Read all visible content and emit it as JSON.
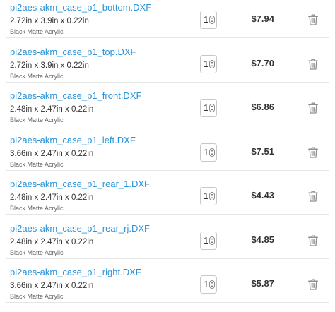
{
  "colors": {
    "link": "#2a93d8",
    "text": "#333333",
    "muted": "#666666",
    "price": "#333333",
    "icon": "#8e8e8e"
  },
  "cart": {
    "items": [
      {
        "name": "pi2aes-akm_case_p1_bottom.DXF",
        "dimensions": "2.72in x 3.9in x 0.22in",
        "material": "Black Matte Acrylic",
        "quantity": "1",
        "price": "$7.94",
        "delete_icon": "trash-icon"
      },
      {
        "name": "pi2aes-akm_case_p1_top.DXF",
        "dimensions": "2.72in x 3.9in x 0.22in",
        "material": "Black Matte Acrylic",
        "quantity": "1",
        "price": "$7.70",
        "delete_icon": "trash-icon"
      },
      {
        "name": "pi2aes-akm_case_p1_front.DXF",
        "dimensions": "2.48in x 2.47in x 0.22in",
        "material": "Black Matte Acrylic",
        "quantity": "1",
        "price": "$6.86",
        "delete_icon": "trash-icon"
      },
      {
        "name": "pi2aes-akm_case_p1_left.DXF",
        "dimensions": "3.66in x 2.47in x 0.22in",
        "material": "Black Matte Acrylic",
        "quantity": "1",
        "price": "$7.51",
        "delete_icon": "trash-icon"
      },
      {
        "name": "pi2aes-akm_case_p1_rear_1.DXF",
        "dimensions": "2.48in x 2.47in x 0.22in",
        "material": "Black Matte Acrylic",
        "quantity": "1",
        "price": "$4.43",
        "delete_icon": "trash-icon"
      },
      {
        "name": "pi2aes-akm_case_p1_rear_rj.DXF",
        "dimensions": "2.48in x 2.47in x 0.22in",
        "material": "Black Matte Acrylic",
        "quantity": "1",
        "price": "$4.85",
        "delete_icon": "trash-icon"
      },
      {
        "name": "pi2aes-akm_case_p1_right.DXF",
        "dimensions": "3.66in x 2.47in x 0.22in",
        "material": "Black Matte Acrylic",
        "quantity": "1",
        "price": "$5.87",
        "delete_icon": "trash-icon"
      }
    ]
  }
}
